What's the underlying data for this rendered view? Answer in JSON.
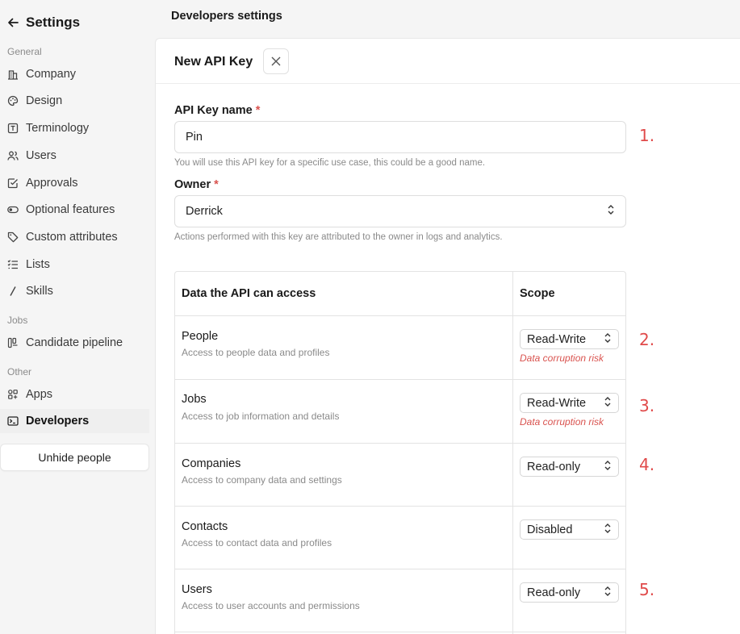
{
  "sidebar": {
    "title": "Settings",
    "sections": {
      "general": "General",
      "jobs": "Jobs",
      "other": "Other"
    },
    "items": [
      {
        "label": "Company",
        "icon": "company-icon"
      },
      {
        "label": "Design",
        "icon": "palette-icon"
      },
      {
        "label": "Terminology",
        "icon": "terminology-icon"
      },
      {
        "label": "Users",
        "icon": "users-icon"
      },
      {
        "label": "Approvals",
        "icon": "approvals-icon"
      },
      {
        "label": "Optional features",
        "icon": "toggle-icon"
      },
      {
        "label": "Custom attributes",
        "icon": "tag-icon"
      },
      {
        "label": "Lists",
        "icon": "list-icon"
      },
      {
        "label": "Skills",
        "icon": "slash-icon"
      },
      {
        "label": "Candidate pipeline",
        "icon": "pipeline-icon"
      },
      {
        "label": "Apps",
        "icon": "apps-icon"
      },
      {
        "label": "Developers",
        "icon": "terminal-icon"
      }
    ],
    "unhide_label": "Unhide people"
  },
  "header": {
    "title": "Developers settings"
  },
  "panel": {
    "title": "New API Key",
    "api_key_name": {
      "label": "API Key name",
      "required_mark": "*",
      "value": "Pin",
      "help": "You will use this API key for a specific use case, this could be a good name."
    },
    "owner": {
      "label": "Owner",
      "required_mark": "*",
      "value": "Derrick",
      "help": "Actions performed with this key are attributed to the owner in logs and analytics."
    },
    "table": {
      "col_data": "Data the API can access",
      "col_scope": "Scope",
      "rows": [
        {
          "name": "People",
          "desc": "Access to people data and profiles",
          "scope": "Read-Write",
          "risk": "Data corruption risk"
        },
        {
          "name": "Jobs",
          "desc": "Access to job information and details",
          "scope": "Read-Write",
          "risk": "Data corruption risk"
        },
        {
          "name": "Companies",
          "desc": "Access to company data and settings",
          "scope": "Read-only",
          "risk": ""
        },
        {
          "name": "Contacts",
          "desc": "Access to contact data and profiles",
          "scope": "Disabled",
          "risk": ""
        },
        {
          "name": "Users",
          "desc": "Access to user accounts and permissions",
          "scope": "Read-only",
          "risk": ""
        }
      ]
    }
  },
  "annotations": [
    "1.",
    "2.",
    "3.",
    "4.",
    "5."
  ],
  "colors": {
    "accent_red": "#e04a4a",
    "required": "#d9534f",
    "sidebar_bg": "#f5f5f5"
  }
}
